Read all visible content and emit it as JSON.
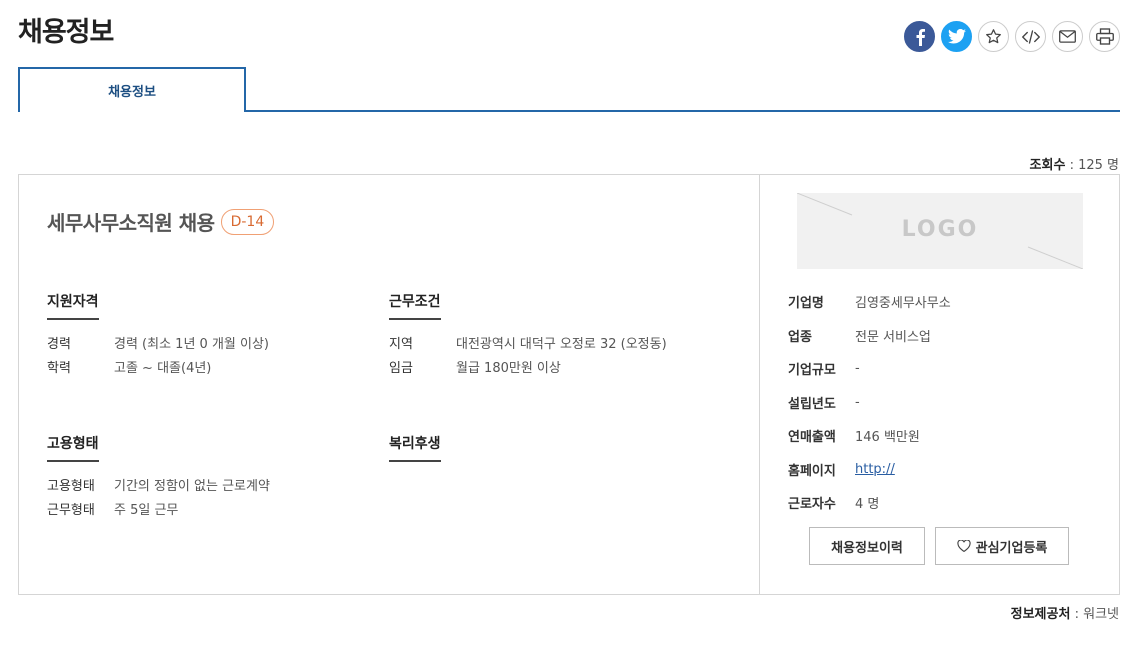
{
  "page": {
    "title": "채용정보"
  },
  "share": [
    {
      "name": "facebook-share-button",
      "icon": "facebook-icon"
    },
    {
      "name": "twitter-share-button",
      "icon": "twitter-icon"
    },
    {
      "name": "bookmark-button",
      "icon": "star-icon"
    },
    {
      "name": "embed-code-button",
      "icon": "code-icon"
    },
    {
      "name": "email-share-button",
      "icon": "mail-icon"
    },
    {
      "name": "print-button",
      "icon": "print-icon"
    }
  ],
  "tabs": [
    {
      "label": "채용정보",
      "active": true
    }
  ],
  "views": {
    "label": "조회수",
    "value": ": 125 명"
  },
  "job": {
    "title": "세무사무소직원 채용",
    "dday": "D-14",
    "qualification": {
      "heading": "지원자격",
      "rows": [
        {
          "label": "경력",
          "value": "경력 (최소 1년 0 개월 이상)"
        },
        {
          "label": "학력",
          "value": "고졸 ~ 대졸(4년)"
        }
      ]
    },
    "conditions": {
      "heading": "근무조건",
      "rows": [
        {
          "label": "지역",
          "value": "대전광역시 대덕구 오정로 32 (오정동)"
        },
        {
          "label": "임금",
          "value": "월급 180만원 이상"
        }
      ]
    },
    "employment": {
      "heading": "고용형태",
      "rows": [
        {
          "label": "고용형태",
          "value": "기간의 정함이 없는 근로계약"
        },
        {
          "label": "근무형태",
          "value": "주 5일 근무"
        }
      ]
    },
    "welfare": {
      "heading": "복리후생"
    }
  },
  "company": {
    "logo_text": "LOGO",
    "rows": [
      {
        "label": "기업명",
        "value": "김영중세무사무소"
      },
      {
        "label": "업종",
        "value": "전문 서비스업"
      },
      {
        "label": "기업규모",
        "value": "-"
      },
      {
        "label": "설립년도",
        "value": "-"
      },
      {
        "label": "연매출액",
        "value": "146 백만원"
      },
      {
        "label": "홈페이지",
        "value": "http://"
      },
      {
        "label": "근로자수",
        "value": "4 명"
      }
    ],
    "buttons": {
      "history": "채용정보이력",
      "favorite": "관심기업등록"
    }
  },
  "source": {
    "label": "정보제공처",
    "value": ": 워크넷"
  },
  "colors": {
    "accent": "#2467a8",
    "dday": "#d86a32",
    "facebook": "#3b5998",
    "twitter": "#1da1f2"
  }
}
